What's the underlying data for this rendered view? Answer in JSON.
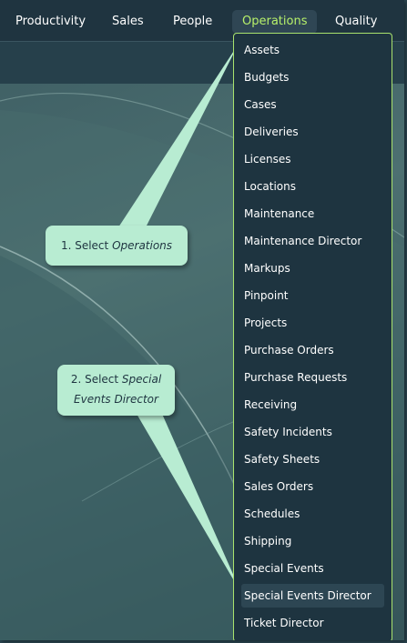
{
  "nav": {
    "items": [
      "Productivity",
      "Sales",
      "People",
      "Operations",
      "Quality"
    ],
    "active": "Operations"
  },
  "dropdown": {
    "items": [
      "Assets",
      "Budgets",
      "Cases",
      "Deliveries",
      "Licenses",
      "Locations",
      "Maintenance",
      "Maintenance Director",
      "Markups",
      "Pinpoint",
      "Projects",
      "Purchase Orders",
      "Purchase Requests",
      "Receiving",
      "Safety Incidents",
      "Safety Sheets",
      "Sales Orders",
      "Schedules",
      "Shipping",
      "Special Events",
      "Special Events Director",
      "Ticket Director"
    ],
    "highlighted": "Special Events Director"
  },
  "callouts": {
    "step1": {
      "prefix": "1. Select ",
      "target": "Operations"
    },
    "step2": {
      "prefix": "2. Select ",
      "target_line1": "Special",
      "target_line2": "Events Director"
    }
  },
  "colors": {
    "nav_bg": "#1f3440",
    "active_text": "#b7f06a",
    "dropdown_border": "#a8e26d",
    "callout_bg": "#b8ecd2"
  }
}
